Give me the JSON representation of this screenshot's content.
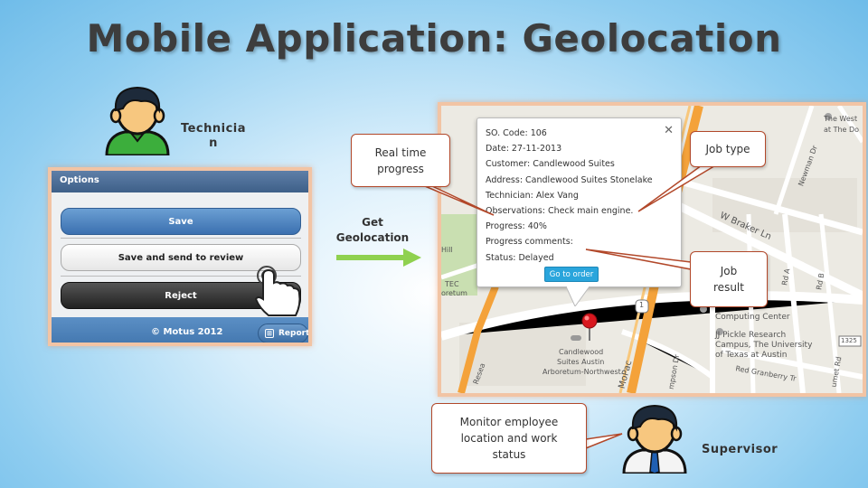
{
  "title": "Mobile Application: Geolocation",
  "technician": {
    "label": "Technicia n"
  },
  "supervisor": {
    "label": "Supervisor"
  },
  "phone": {
    "header": "Options",
    "buttons": {
      "save": "Save",
      "save_review": "Save and send to review",
      "reject": "Reject"
    },
    "footer": {
      "copyright": "© Motus 2012",
      "report": "Report"
    }
  },
  "arrow": {
    "label": "Get Geolocation"
  },
  "popup": {
    "close": "✕",
    "lines": [
      "SO. Code: 106",
      "Date: 27-11-2013",
      "Customer: Candlewood Suites",
      "Address: Candlewood Suites Stonelake",
      "Technician: Alex Vang",
      "Observations: Check main engine.",
      "Progress: 40%",
      "Progress comments:",
      "Status: Delayed"
    ],
    "goto": "Go to order"
  },
  "callouts": {
    "realtime": "Real time progress",
    "jobtype": "Job type",
    "jobresult": "Job result",
    "monitor": "Monitor employee location and work status"
  },
  "map": {
    "labels": {
      "westin1": "The West",
      "westin2": "at The Do",
      "braker": "W Braker Ln",
      "newman": "Newman Dr",
      "computing": "Computing Center",
      "jjp1": "JJ Pickle Research",
      "jjp2": "Campus, The University",
      "jjp3": "of Texas at Austin",
      "granberry": "Red Granberry Tr",
      "mopac": "MoPac",
      "candlewood1": "Candlewood",
      "candlewood2": "Suites Austin",
      "candlewood3": "Arboretum-Northwest",
      "arboretum1": "TEC",
      "arboretum2": "oretum",
      "hwy1": "1",
      "hwy1325": "1325",
      "hill": "Hill",
      "resea": "Resea",
      "rd1": "Rd A",
      "rd2": "Rd B",
      "rdend": "umet Rd",
      "simpson": "mpson Dr"
    },
    "colors": {
      "highway": "#f4a23a",
      "road": "#ffffff",
      "park": "#c9dfb1"
    }
  },
  "colors": {
    "callout_border": "#b2482a",
    "arrow": "#8fd14f"
  }
}
